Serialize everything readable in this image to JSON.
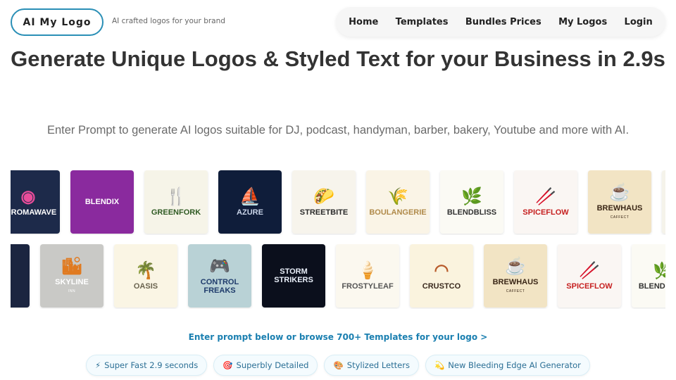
{
  "brand": {
    "name": "AI My Logo",
    "tagline": "AI crafted logos for your brand"
  },
  "nav": [
    "Home",
    "Templates",
    "Bundles Prices",
    "My Logos",
    "Login"
  ],
  "hero": {
    "title": "Generate Unique Logos & Styled Text for your Business in 2.9s",
    "subtitle": "Enter Prompt to generate AI logos suitable for DJ, podcast, handyman, barber, bakery, Youtube and more with AI."
  },
  "gallery": {
    "row1": [
      {
        "text": "CHROMAWAVE",
        "sym": "◉",
        "bg": "#1d2a4a",
        "fg": "#ffffff",
        "sym_color": "#e84d9a"
      },
      {
        "text": "BLENDIX",
        "sym": "",
        "bg": "#8a2a9e",
        "fg": "#ffffff",
        "sym_color": "#ffffff"
      },
      {
        "text": "GREENFORK",
        "sym": "🍴",
        "bg": "#f6f4e8",
        "fg": "#2f5a23",
        "sym_color": "#3d6e2a"
      },
      {
        "text": "AZURE",
        "sym": "⛵",
        "bg": "#0f1d3a",
        "fg": "#c9d4e8",
        "sym_color": "#c9d4e8"
      },
      {
        "text": "STREETBITE",
        "sym": "🌮",
        "bg": "#f7f4ec",
        "fg": "#2a2a2a",
        "sym_color": "#e0a020"
      },
      {
        "text": "BOULANGERIE",
        "sym": "🌾",
        "bg": "#faf4e6",
        "fg": "#b08a4a",
        "sym_color": "#c39a4e"
      },
      {
        "text": "BLENDBLISS",
        "sym": "🌿",
        "bg": "#fbfaf4",
        "fg": "#333333",
        "sym_color": "#4b8a2d"
      },
      {
        "text": "SPICEFLOW",
        "sym": "🥢",
        "bg": "#faf6f3",
        "fg": "#c62020",
        "sym_color": "#c62020"
      },
      {
        "text": "BREWHAUS",
        "sub": "CAFFECT",
        "sym": "☕",
        "bg": "#f2e4c4",
        "fg": "#3a2616",
        "sym_color": "#3a2616"
      },
      {
        "text": "",
        "sym": "",
        "bg": "#f5f3ea",
        "fg": "#333333",
        "sym_color": "#333333"
      }
    ],
    "row2": [
      {
        "text": "",
        "sym": "",
        "bg": "#1b2540",
        "fg": "#ffffff",
        "sym_color": "#ffffff"
      },
      {
        "text": "SKYLINE",
        "sub": "INN",
        "sym": "🏙",
        "bg": "#c9c9c6",
        "fg": "#ffffff",
        "sym_color": "#e07a20"
      },
      {
        "text": "OASIS",
        "sym": "🌴",
        "bg": "#faf5e4",
        "fg": "#6b6450",
        "sym_color": "#c9902e"
      },
      {
        "text": "CONTROL FREAKS",
        "sym": "🎮",
        "bg": "#b9d2d6",
        "fg": "#1e3b6b",
        "sym_color": "#1e3b6b"
      },
      {
        "text": "STORM STRIKERS",
        "sym": "",
        "bg": "#0b0f1c",
        "fg": "#e8eef8",
        "sym_color": "#e8eef8"
      },
      {
        "text": "FROSTYLEAF",
        "sym": "🍦",
        "bg": "#fbf8ef",
        "fg": "#555555",
        "sym_color": "#7fbf6a"
      },
      {
        "text": "CRUSTCO",
        "sym": "◠",
        "bg": "#faf3de",
        "fg": "#3a2a1e",
        "sym_color": "#b85a2a"
      },
      {
        "text": "BREWHAUS",
        "sub": "CAFFECT",
        "sym": "☕",
        "bg": "#f2e4c4",
        "fg": "#3a2616",
        "sym_color": "#3a2616"
      },
      {
        "text": "SPICEFLOW",
        "sym": "🥢",
        "bg": "#faf6f3",
        "fg": "#c62020",
        "sym_color": "#c62020"
      },
      {
        "text": "BLENDBLISS",
        "sym": "🌿",
        "bg": "#fbfaf4",
        "fg": "#333333",
        "sym_color": "#4b8a2d"
      }
    ]
  },
  "cta": "Enter prompt below or browse 700+ Templates for your logo >",
  "features": [
    {
      "icon": "⚡",
      "icon_name": "lightning-icon",
      "label": "Super Fast 2.9 seconds"
    },
    {
      "icon": "🎯",
      "icon_name": "target-icon",
      "label": "Superbly Detailed"
    },
    {
      "icon": "🎨",
      "icon_name": "palette-icon",
      "label": "Stylized Letters"
    },
    {
      "icon": "💫",
      "icon_name": "sparkle-icon",
      "label": "New Bleeding Edge AI Generator"
    }
  ],
  "colors": {
    "accent": "#2a8fb6",
    "link": "#1a7fb0"
  }
}
